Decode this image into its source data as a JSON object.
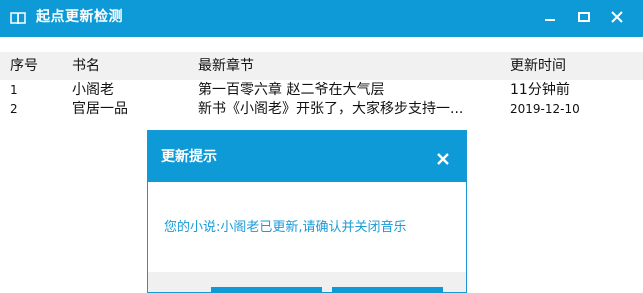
{
  "window": {
    "title": "起点更新检测",
    "icon": "book-icon",
    "controls": [
      "minimize-icon",
      "maximize-icon",
      "close-icon"
    ]
  },
  "table": {
    "headers": [
      "序号",
      "书名",
      "最新章节",
      "更新时间"
    ],
    "rows": [
      {
        "index": "1",
        "title": "小阁老",
        "latest_chapter": "第一百零六章 赵二爷在大气层",
        "update_time": "11分钟前"
      },
      {
        "index": "2",
        "title": "官居一品",
        "latest_chapter": "新书《小阁老》开张了，大家移步支持一...",
        "update_time": "2019-12-10"
      }
    ]
  },
  "dialog": {
    "title": "更新提示",
    "close_icon": "close-icon",
    "message": "您的小说:小阁老已更新,请确认并关闭音乐"
  },
  "colors": {
    "accent": "#0e9ad6",
    "message_text": "#1b9bd7",
    "header_bg": "#f1f1f1"
  }
}
